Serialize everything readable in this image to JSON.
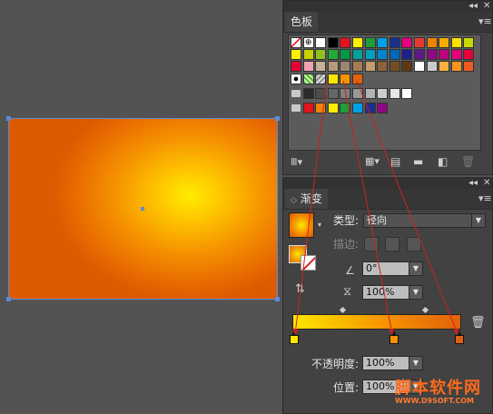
{
  "swatches_panel": {
    "tab_label": "色板"
  },
  "gradient_panel": {
    "tab_label": "渐变",
    "type_label": "类型:",
    "type_value": "径向",
    "stroke_label": "描边:",
    "angle_value": "0°",
    "aspect_value": "100%",
    "opacity_label": "不透明度:",
    "opacity_value": "100%",
    "location_label": "位置:",
    "location_value": "100%",
    "stops": [
      {
        "color": "#ffe600"
      },
      {
        "color": "#f59300"
      },
      {
        "color": "#e0610c"
      }
    ]
  },
  "colors": {
    "gradient_center": "#ffec00",
    "gradient_mid": "#f59300",
    "gradient_edge": "#de5a00",
    "selection": "#5b8cd6",
    "annotation_arrow": "#d02020"
  },
  "watermark": {
    "text_cn": "脚本软件网",
    "text_en": "WWW.D9SOFT.COM"
  },
  "icons": [
    "collapse-icon",
    "close-icon",
    "panel-menu-icon",
    "swatch-library-icon",
    "show-kinds-icon",
    "swatch-options-icon",
    "new-color-group-icon",
    "new-swatch-icon",
    "delete-swatch-icon",
    "reverse-gradient-icon",
    "angle-icon",
    "aspect-ratio-icon",
    "delete-stop-icon",
    "folder-icon"
  ]
}
